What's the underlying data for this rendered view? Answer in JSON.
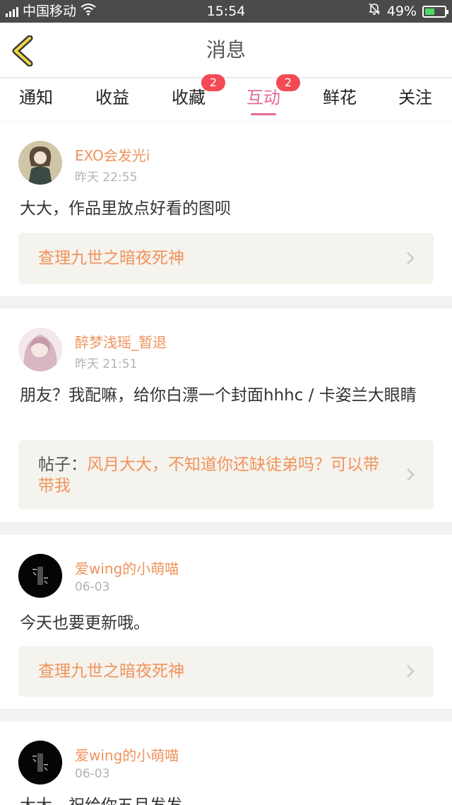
{
  "status_bar": {
    "carrier": "中国移动",
    "time": "15:54",
    "battery": "49%",
    "battery_level": 0.49
  },
  "nav": {
    "title": "消息"
  },
  "tabs": [
    {
      "label": "通知",
      "badge": ""
    },
    {
      "label": "收益",
      "badge": ""
    },
    {
      "label": "收藏",
      "badge": "2"
    },
    {
      "label": "互动",
      "badge": "2"
    },
    {
      "label": "鲜花",
      "badge": ""
    },
    {
      "label": "关注",
      "badge": ""
    }
  ],
  "active_tab": "互动",
  "messages": [
    {
      "username": "EXO会发光i",
      "time": "昨天 22:55",
      "content": "大大，作品里放点好看的图呗",
      "ref_prefix": "",
      "ref_text": "查理九世之暗夜死神"
    },
    {
      "username": "醉梦浅瑶_暂退",
      "time": "昨天 21:51",
      "content": "朋友？我配嘛，给你白漂一个封面hhhc / 卡姿兰大眼睛",
      "ref_prefix": "帖子：",
      "ref_text": "风月大大，不知道你还缺徒弟吗？可以带带我"
    },
    {
      "username": "爱wing的小萌喵",
      "time": "06-03",
      "content": "今天也要更新哦。",
      "ref_prefix": "",
      "ref_text": "查理九世之暗夜死神"
    },
    {
      "username": "爱wing的小萌喵",
      "time": "06-03",
      "content": "大大，祝给你五月发发",
      "ref_prefix": "",
      "ref_text": ""
    }
  ],
  "colors": {
    "accent_pink": "#e66a9a",
    "username_orange": "#f0935c",
    "badge_red": "#f34a55",
    "back_yellow": "#f3d843"
  }
}
